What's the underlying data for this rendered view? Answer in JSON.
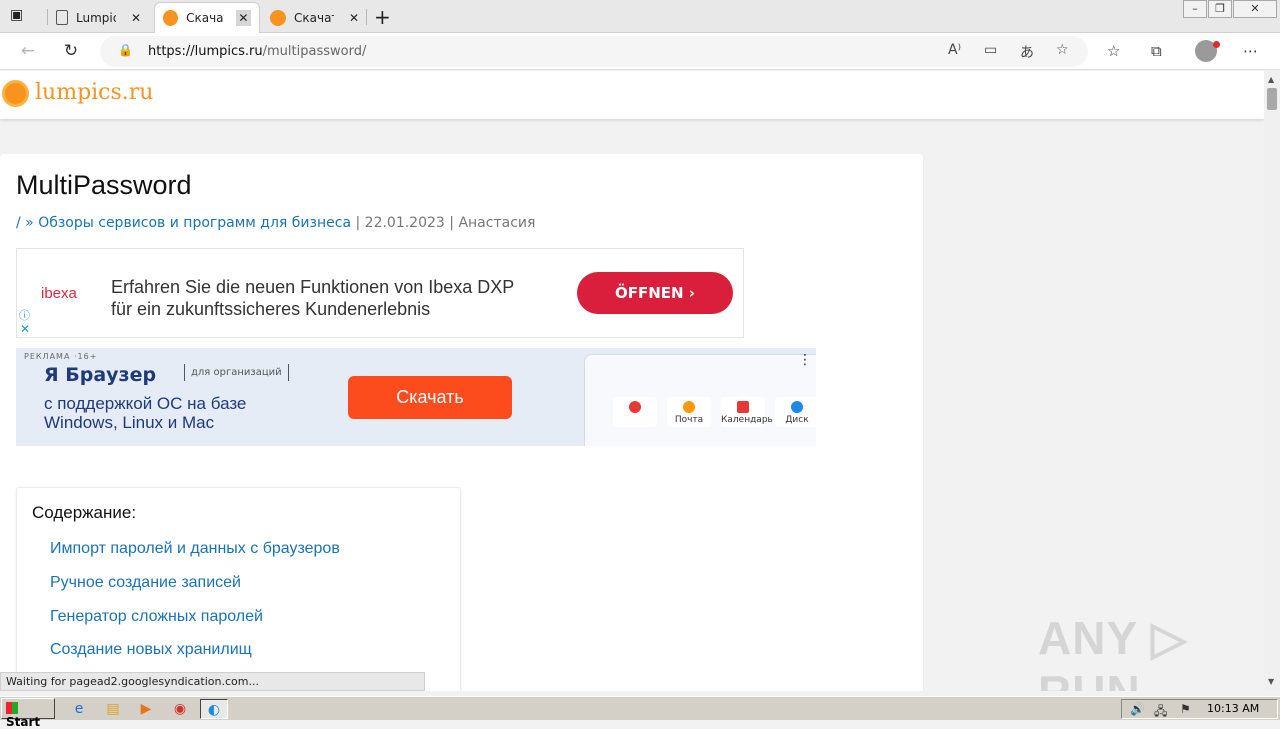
{
  "browser": {
    "tabs": [
      {
        "title": "Lumpics",
        "active": false
      },
      {
        "title": "Скачать",
        "active": true
      },
      {
        "title": "Скачать",
        "active": false
      }
    ],
    "url_host": "https://lumpics.ru",
    "url_path": "/multipassword/",
    "close_glyph": "✕",
    "new_tab_glyph": "+"
  },
  "site": {
    "logo_text": "lumpics.ru"
  },
  "article": {
    "title": "MultiPassword",
    "breadcrumb_home": "/",
    "breadcrumb_sep": " » ",
    "breadcrumb_category": "Обзоры сервисов и программ для бизнеса",
    "date": "22.01.2023",
    "author": "Анастасия",
    "meta_sep": " | "
  },
  "ad_ibexa": {
    "brand": "ibexa",
    "line1": "Erfahren Sie die neuen Funktionen von Ibexa DXP",
    "line2": "für ein zukunftssicheres Kundenerlebnis",
    "cta": "ÖFFNEN  ›",
    "info": "ⓘ",
    "close": "✕",
    "accent": "#d91f3c"
  },
  "ad_yandex": {
    "tag": "РЕКЛАМА ·16+",
    "brand": "Я Браузер",
    "org": "для организаций",
    "line1": "с поддержкой ОС на базе",
    "line2": "Windows, Linux и Mac",
    "cta": "Скачать",
    "tiles": [
      {
        "label": "Я",
        "color": "#e53935"
      },
      {
        "label": "Почта",
        "color": "#ff9800"
      },
      {
        "label": "Календарь",
        "color": "#e53935"
      },
      {
        "label": "Диск",
        "color": "#1e88e5"
      }
    ],
    "menu": "⋮",
    "accent": "#fc4c1e"
  },
  "toc": {
    "title": "Содержание:",
    "items": [
      "Импорт паролей и данных с браузеров",
      "Ручное создание записей",
      "Генератор сложных паролей",
      "Создание новых хранилищ"
    ]
  },
  "status_text": "Waiting for pagead2.googlesyndication.com...",
  "watermark": "ANY ▷ RUN",
  "taskbar": {
    "start": "Start",
    "clock": "10:13 AM"
  }
}
